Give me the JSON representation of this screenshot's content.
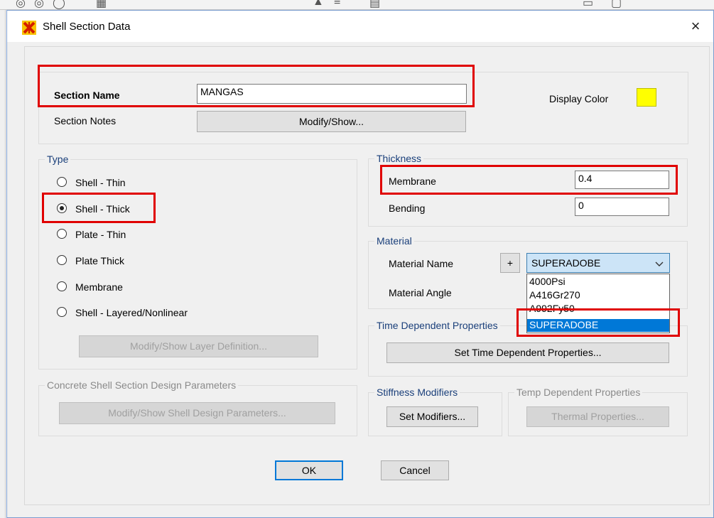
{
  "dialog": {
    "title": "Shell Section Data",
    "close_label": "×"
  },
  "section": {
    "name_label": "Section Name",
    "name_value": "MANGAS",
    "notes_label": "Section Notes",
    "notes_button": "Modify/Show...",
    "display_color_label": "Display Color",
    "display_color": "#ffff00"
  },
  "type": {
    "legend": "Type",
    "options": [
      {
        "label": "Shell - Thin",
        "checked": false
      },
      {
        "label": "Shell - Thick",
        "checked": true
      },
      {
        "label": "Plate - Thin",
        "checked": false
      },
      {
        "label": "Plate Thick",
        "checked": false
      },
      {
        "label": "Membrane",
        "checked": false
      },
      {
        "label": "Shell - Layered/Nonlinear",
        "checked": false
      }
    ],
    "layer_button": "Modify/Show Layer Definition..."
  },
  "thickness": {
    "legend": "Thickness",
    "membrane_label": "Membrane",
    "membrane_value": "0.4",
    "bending_label": "Bending",
    "bending_value": "0"
  },
  "material": {
    "legend": "Material",
    "name_label": "Material Name",
    "add_button": "+",
    "selected": "SUPERADOBE",
    "angle_label": "Material Angle",
    "options": [
      "4000Psi",
      "A416Gr270",
      "A992Fy50",
      "SUPERADOBE"
    ]
  },
  "time_dependent": {
    "legend": "Time Dependent Properties",
    "button": "Set Time Dependent Properties..."
  },
  "concrete": {
    "legend": "Concrete Shell Section Design Parameters",
    "button": "Modify/Show Shell Design Parameters..."
  },
  "stiffness": {
    "legend": "Stiffness Modifiers",
    "button": "Set Modifiers..."
  },
  "temp": {
    "legend": "Temp Dependent Properties",
    "button": "Thermal Properties..."
  },
  "footer": {
    "ok": "OK",
    "cancel": "Cancel"
  },
  "colors": {
    "highlight": "#e00000",
    "accent": "#0078d7"
  }
}
